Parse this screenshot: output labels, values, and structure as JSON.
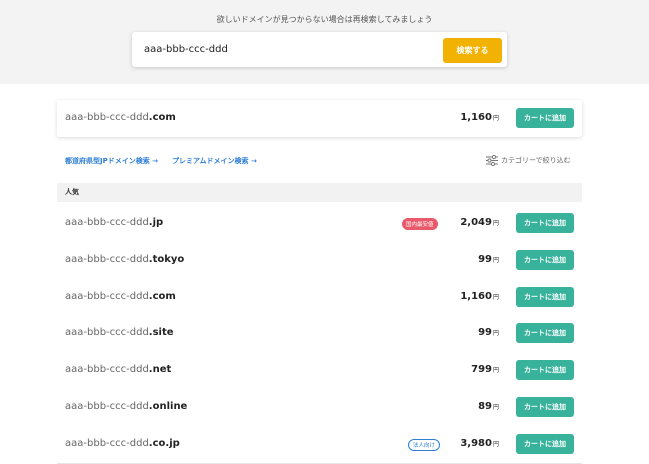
{
  "search": {
    "hint": "欲しいドメインが見つからない場合は再検索してみましょう",
    "value": "aaa-bbb-ccc-ddd",
    "button_label": "検索する"
  },
  "featured": {
    "name": "aaa-bbb-ccc-ddd",
    "tld": ".com",
    "price": "1,160",
    "yen": "円",
    "button_label": "カートに追加"
  },
  "links": {
    "jp_label": "都道府県型JPドメイン検索 →",
    "premium_label": "プレミアムドメイン検索 →"
  },
  "filter": {
    "label": "カテゴリーで絞り込む"
  },
  "section": {
    "title": "人気"
  },
  "rows": [
    {
      "name": "aaa-bbb-ccc-ddd",
      "tld": ".jp",
      "price": "2,049",
      "yen": "円",
      "badge": "国内最安値",
      "badge_style": "red",
      "button_label": "カートに追加"
    },
    {
      "name": "aaa-bbb-ccc-ddd",
      "tld": ".tokyo",
      "price": "99",
      "yen": "円",
      "badge": "",
      "button_label": "カートに追加"
    },
    {
      "name": "aaa-bbb-ccc-ddd",
      "tld": ".com",
      "price": "1,160",
      "yen": "円",
      "badge": "",
      "button_label": "カートに追加"
    },
    {
      "name": "aaa-bbb-ccc-ddd",
      "tld": ".site",
      "price": "99",
      "yen": "円",
      "badge": "",
      "button_label": "カートに追加"
    },
    {
      "name": "aaa-bbb-ccc-ddd",
      "tld": ".net",
      "price": "799",
      "yen": "円",
      "badge": "",
      "button_label": "カートに追加"
    },
    {
      "name": "aaa-bbb-ccc-ddd",
      "tld": ".online",
      "price": "89",
      "yen": "円",
      "badge": "",
      "button_label": "カートに追加"
    },
    {
      "name": "aaa-bbb-ccc-ddd",
      "tld": ".co.jp",
      "price": "3,980",
      "yen": "円",
      "badge": "法人向け",
      "badge_style": "blue",
      "button_label": "カートに追加"
    }
  ]
}
